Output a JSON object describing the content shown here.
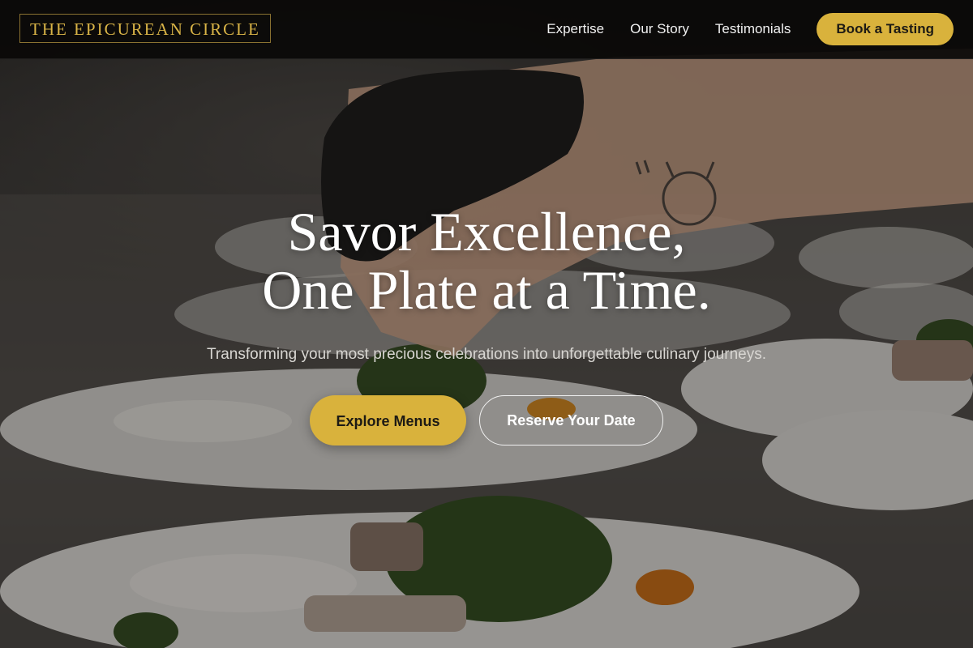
{
  "header": {
    "logo_text": "THE EPICUREAN CIRCLE",
    "nav": [
      {
        "label": "Expertise"
      },
      {
        "label": "Our Story"
      },
      {
        "label": "Testimonials"
      }
    ],
    "cta_label": "Book a Tasting"
  },
  "hero": {
    "title_line1": "Savor Excellence,",
    "title_line2": "One Plate at a Time.",
    "subtitle": "Transforming your most precious celebrations into unforgettable culinary journeys.",
    "primary_button": "Explore Menus",
    "secondary_button": "Reserve Your Date"
  },
  "colors": {
    "accent_gold": "#d9b23c",
    "header_bg": "#0a0908",
    "text_light": "#ffffff"
  }
}
